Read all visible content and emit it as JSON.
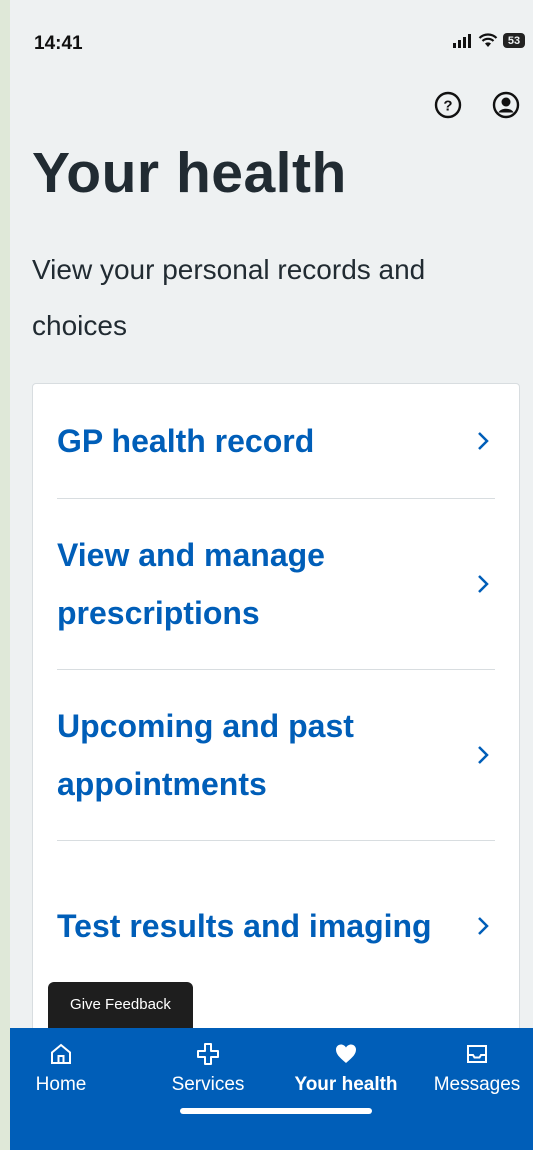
{
  "status_bar": {
    "time": "14:41",
    "battery": "53"
  },
  "header": {
    "help_icon": "help-circle-icon",
    "profile_icon": "account-circle-icon"
  },
  "page": {
    "title": "Your health",
    "subtitle": "View your personal records and choices"
  },
  "menu": {
    "items": [
      {
        "label": "GP health record"
      },
      {
        "label": "View and manage prescriptions"
      },
      {
        "label": "Upcoming and past appointments"
      },
      {
        "label": "Test results and imaging"
      }
    ]
  },
  "feedback": {
    "label": "Give Feedback"
  },
  "tabs": [
    {
      "label": "Home",
      "icon": "home-icon"
    },
    {
      "label": "Services",
      "icon": "cross-icon"
    },
    {
      "label": "Your health",
      "icon": "heart-icon",
      "active": true
    },
    {
      "label": "Messages",
      "icon": "inbox-icon"
    }
  ],
  "colors": {
    "brand_blue": "#005eb8",
    "background": "#eef1f2",
    "text": "#212b32"
  }
}
